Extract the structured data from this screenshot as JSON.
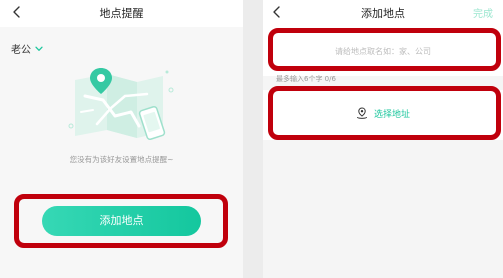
{
  "left_screen": {
    "title": "地点提醒",
    "friend_name": "老公",
    "empty_message": "您没有为该好友设置地点提醒~",
    "add_button_label": "添加地点"
  },
  "right_screen": {
    "title": "添加地点",
    "done_label": "完成",
    "name_placeholder": "请给地点取名如：家、公司",
    "name_hint": "最多输入6个字 0/6",
    "select_address_label": "选择地址"
  },
  "icons": {
    "back": "chevron-left-icon",
    "dropdown": "chevron-down-icon",
    "location_pin": "location-pin-icon",
    "illustration": "map-phone-illustration"
  },
  "colors": {
    "accent": "#1ec79e",
    "accent_light": "#9be6cf",
    "highlight_box": "#c0000c",
    "text_muted": "#999999"
  }
}
